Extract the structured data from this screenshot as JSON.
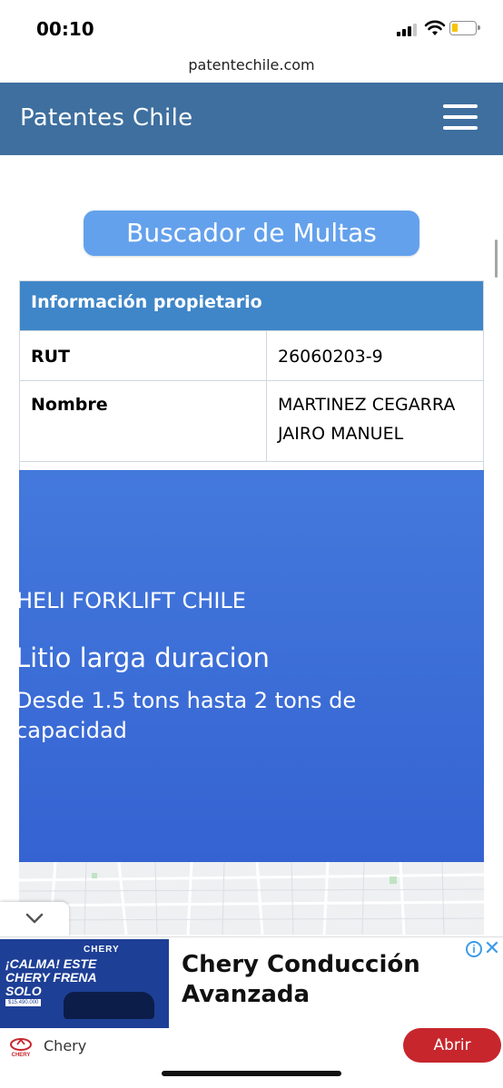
{
  "status_bar": {
    "time": "00:10"
  },
  "browser": {
    "url": "patentechile.com"
  },
  "header": {
    "title": "Patentes Chile",
    "menu_icon": "hamburger-menu-icon"
  },
  "search_button": {
    "label": "Buscador de Multas"
  },
  "owner_table": {
    "heading": "Información propietario",
    "rows": [
      {
        "label": "RUT",
        "value": "26060203-9"
      },
      {
        "label": "Nombre",
        "value_line1": "MARTINEZ CEGARRA",
        "value_line2": "JAIRO MANUEL"
      }
    ]
  },
  "ad": {
    "brand": "HELI FORKLIFT CHILE",
    "headline": "Litio larga duracion",
    "description": "Desde 1.5 tons hasta 2 tons de capacidad",
    "background_color": "#3f6fd9"
  },
  "banner": {
    "image_brand": "CHERY",
    "image_headline": "¡CALMA! ESTE CHERY FRENA SOLO",
    "image_price": "$15.490.000",
    "title_line1": "Chery Conducción",
    "title_line2": "Avanzada",
    "advertiser": "Chery",
    "cta": "Abrir",
    "cta_color": "#c7262d",
    "collapse_icon": "chevron-down-icon",
    "info_icon": "info-icon",
    "close_icon": "close-icon"
  }
}
